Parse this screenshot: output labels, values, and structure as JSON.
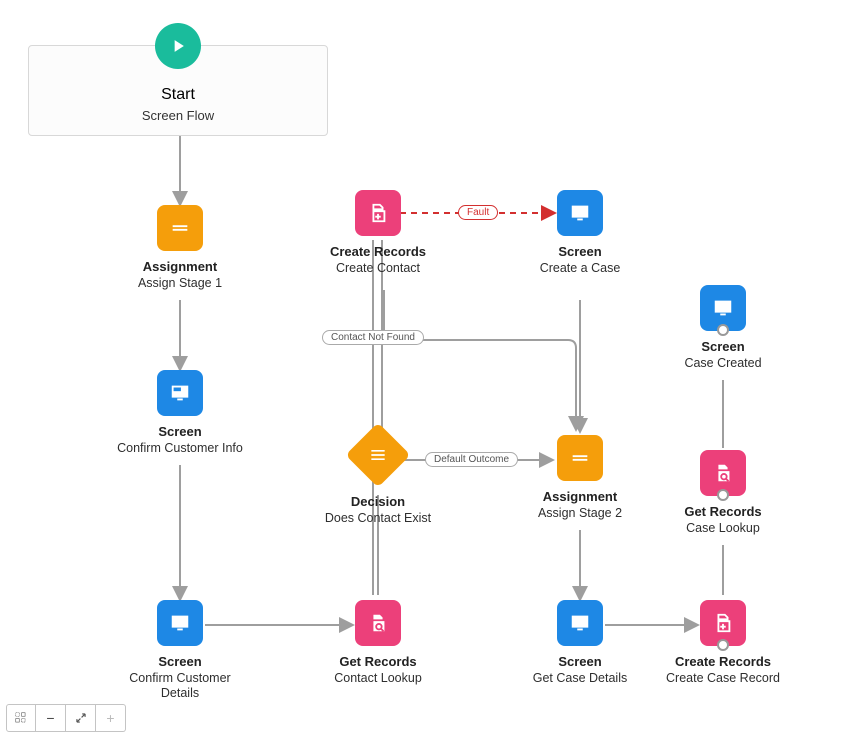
{
  "start": {
    "title": "Start",
    "subtitle": "Screen Flow"
  },
  "fault_label": "Fault",
  "connector_labels": {
    "contact_not_found": "Contact Not Found",
    "default_outcome": "Default Outcome"
  },
  "nodes": {
    "assign1": {
      "type": "Assignment",
      "title": "Assignment",
      "sub": "Assign Stage 1"
    },
    "screen_info": {
      "type": "Screen",
      "title": "Screen",
      "sub": "Confirm Customer Info"
    },
    "screen_details": {
      "type": "Screen",
      "title": "Screen",
      "sub": "Confirm Customer Details"
    },
    "create_contact": {
      "type": "Create Records",
      "title": "Create Records",
      "sub": "Create Contact"
    },
    "decision": {
      "type": "Decision",
      "title": "Decision",
      "sub": "Does Contact Exist"
    },
    "get_contact": {
      "type": "Get Records",
      "title": "Get Records",
      "sub": "Contact Lookup"
    },
    "screen_case": {
      "type": "Screen",
      "title": "Screen",
      "sub": "Create a Case"
    },
    "assign2": {
      "type": "Assignment",
      "title": "Assignment",
      "sub": "Assign Stage 2"
    },
    "screen_getcase": {
      "type": "Screen",
      "title": "Screen",
      "sub": "Get Case Details"
    },
    "screen_created": {
      "type": "Screen",
      "title": "Screen",
      "sub": "Case Created"
    },
    "get_case": {
      "type": "Get Records",
      "title": "Get Records",
      "sub": "Case Lookup"
    },
    "create_case": {
      "type": "Create Records",
      "title": "Create Records",
      "sub": "Create Case Record"
    }
  },
  "toolbar": {
    "select_tool": "select",
    "zoom_out": "zoom-out",
    "fit": "fit",
    "zoom_in": "zoom-in"
  }
}
